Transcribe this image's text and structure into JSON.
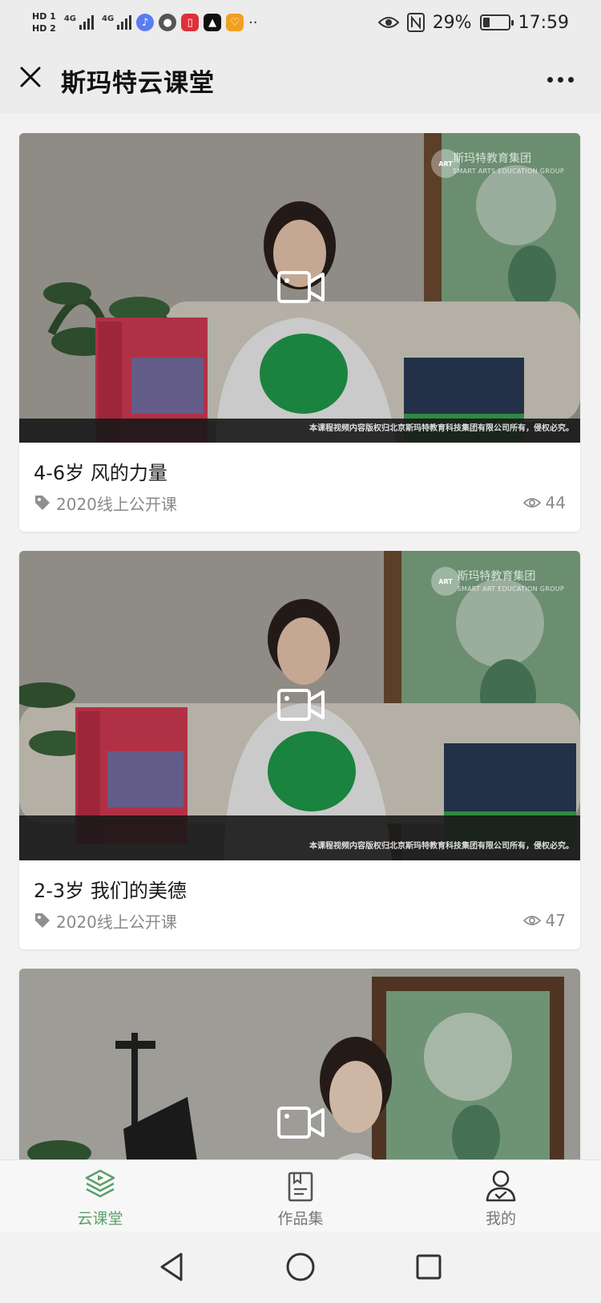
{
  "status_bar": {
    "hd1": "HD 1",
    "hd2": "HD 2",
    "net1": "4G",
    "net2": "4G",
    "more": "··",
    "battery_level": 0.29,
    "battery_text": "29%",
    "time": "17:59"
  },
  "header": {
    "title": "斯玛特云课堂"
  },
  "courses": [
    {
      "title": "4-6岁 风的力量",
      "tag": "2020线上公开课",
      "views": "44",
      "watermark_cn": "斯玛特教育集团",
      "watermark_en": "SMART ARTS EDUCATION GROUP",
      "copyright": "本课程视频内容版权归北京斯玛特教育科技集团有限公司所有，侵权必究。",
      "colors": [
        "#a7a39a",
        "#d6d2c8",
        "#6a8f6c"
      ]
    },
    {
      "title": "2-3岁 我们的美德",
      "tag": "2020线上公开课",
      "views": "47",
      "watermark_cn": "斯玛特教育集团",
      "watermark_en": "SMART ART EDUCATION GROUP",
      "copyright": "本课程视频内容版权归北京斯玛特教育科技集团有限公司所有，侵权必究。",
      "colors": [
        "#a8a59d",
        "#d4d0c6",
        "#6a8f6c"
      ]
    },
    {
      "title": "",
      "tag": "",
      "views": "",
      "colors": [
        "#b2b0aa",
        "#d9d6cf",
        "#6a8f6c"
      ]
    }
  ],
  "tabbar": {
    "items": [
      {
        "label": "云课堂",
        "icon": "play-stack-icon",
        "active": true
      },
      {
        "label": "作品集",
        "icon": "document-book-icon",
        "active": false
      },
      {
        "label": "我的",
        "icon": "user-icon",
        "active": false
      }
    ]
  },
  "theme": {
    "accent": "#5aa06a",
    "muted": "#8a8a8a"
  }
}
